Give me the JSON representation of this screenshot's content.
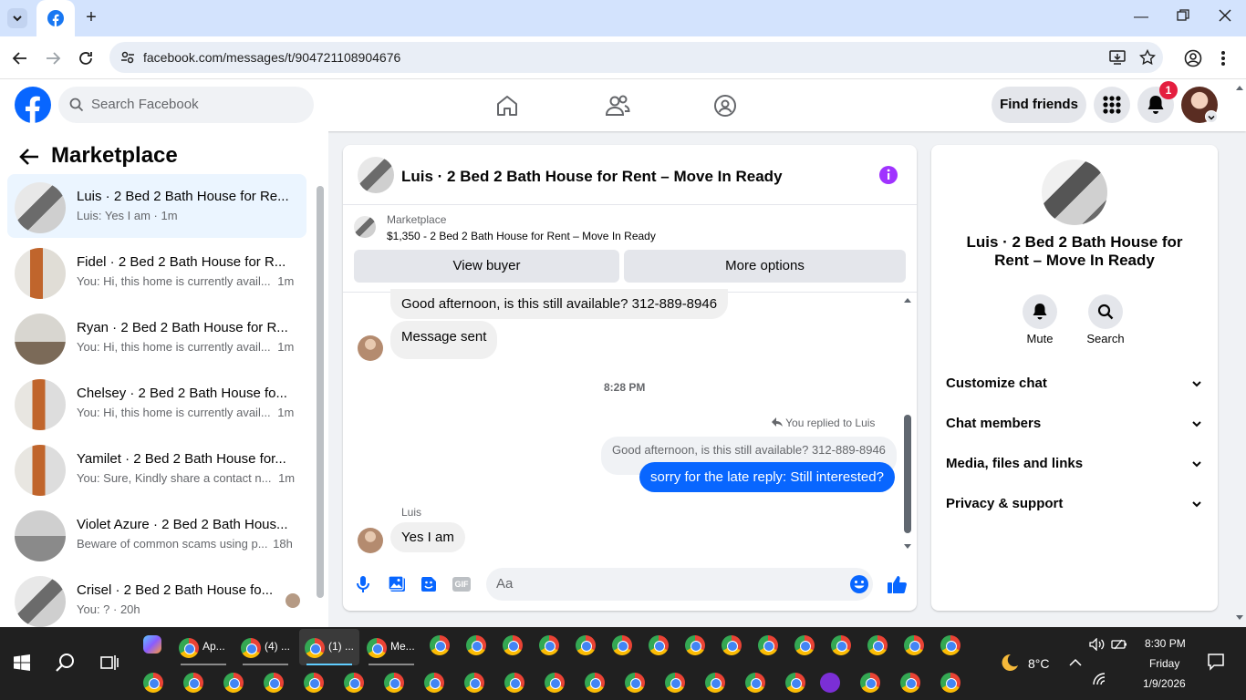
{
  "browser": {
    "url": "facebook.com/messages/t/904721108904676"
  },
  "facebook": {
    "search_placeholder": "Search Facebook",
    "find_friends": "Find friends",
    "notif_count": "1"
  },
  "sidebar": {
    "title": "Marketplace",
    "conversations": [
      {
        "name": "Luis · 2 Bed 2 Bath House for Re...",
        "snippet": "Luis: Yes I am · 1m"
      },
      {
        "name": "Fidel · 2 Bed 2 Bath House for R...",
        "snippet": "You: Hi, this home is currently avail...",
        "time": "1m"
      },
      {
        "name": "Ryan · 2 Bed 2 Bath House for R...",
        "snippet": "You: Hi, this home is currently avail...",
        "time": "1m"
      },
      {
        "name": "Chelsey · 2 Bed 2 Bath House fo...",
        "snippet": "You: Hi, this home is currently avail...",
        "time": "1m"
      },
      {
        "name": "Yamilet · 2 Bed 2 Bath House for...",
        "snippet": "You: Sure, Kindly share a contact n...",
        "time": "1m"
      },
      {
        "name": "Violet Azure · 2 Bed 2 Bath Hous...",
        "snippet": "Beware of common scams using p...",
        "time": "18h"
      },
      {
        "name": "Crisel · 2 Bed 2 Bath House fo...",
        "snippet": "You: ? · 20h"
      }
    ]
  },
  "chat": {
    "title": "Luis · 2 Bed 2 Bath House for Rent – Move In Ready",
    "listing_source": "Marketplace",
    "listing_desc": "$1,350 - 2 Bed 2 Bath House for Rent – Move In Ready",
    "view_buyer": "View buyer",
    "more_options": "More options",
    "msg1": "Good afternoon, is this still available? 312-889-8946",
    "msg2": "Message sent",
    "timestamp": "8:28 PM",
    "replied_to": "You replied to Luis",
    "quoted": "Good afternoon, is this still available? 312-889-8946",
    "reply": "sorry for the late reply: Still interested?",
    "sender": "Luis",
    "msg3": "Yes I am",
    "composer_placeholder": "Aa"
  },
  "details": {
    "title": "Luis · 2 Bed 2 Bath House for Rent – Move In Ready",
    "mute": "Mute",
    "search": "Search",
    "sections": [
      "Customize chat",
      "Chat members",
      "Media, files and links",
      "Privacy & support"
    ]
  },
  "taskbar": {
    "apps": [
      "Ap...",
      "(4) ...",
      "(1) ...",
      "Me..."
    ],
    "temp": "8°C",
    "time": "8:30 PM",
    "day": "Friday",
    "date": "1/9/2026"
  },
  "colors": {
    "accent": "#0866ff",
    "fb_blue": "#1877f2",
    "purple": "#a033ff"
  }
}
